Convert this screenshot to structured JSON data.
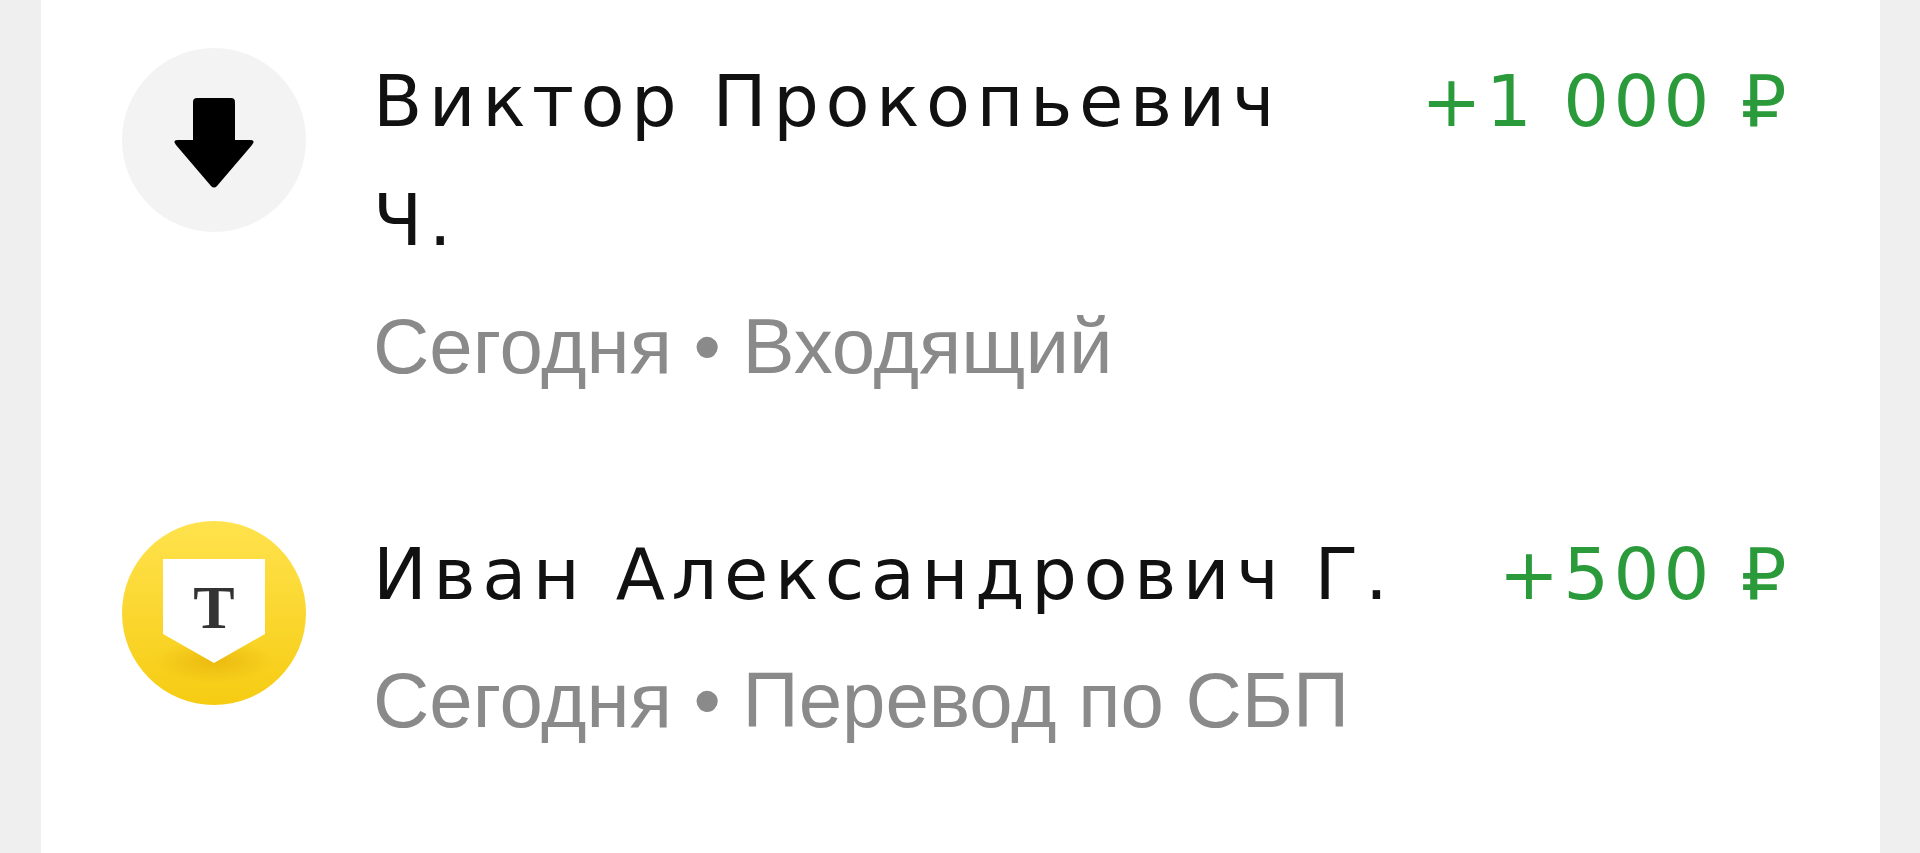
{
  "transactions": [
    {
      "icon": {
        "kind": "incoming"
      },
      "name": "Виктор Прокопьевич Ч.",
      "amount": "+1 000 ₽",
      "subtitle": "Сегодня • Входящий"
    },
    {
      "icon": {
        "kind": "bank-logo",
        "letter": "Т"
      },
      "name": "Иван Александрович Г.",
      "amount": "+500 ₽",
      "subtitle": "Сегодня • Перевод по СБП"
    }
  ]
}
